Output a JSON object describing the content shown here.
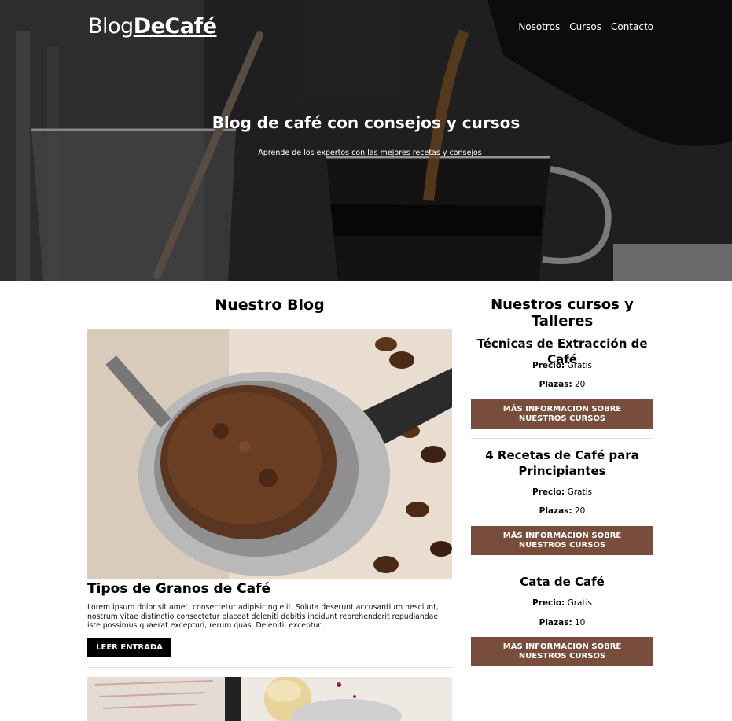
{
  "logo": {
    "light": "Blog",
    "bold": "DeCafé"
  },
  "nav": [
    "Nosotros",
    "Cursos",
    "Contacto"
  ],
  "hero": {
    "title": "Blog de café con consejos y cursos",
    "subtitle": "Aprende de los expertos con las mejores recetas y consejos"
  },
  "blog": {
    "heading": "Nuestro Blog",
    "posts": [
      {
        "title": "Tipos de Granos de Café",
        "excerpt": "Lorem ipsum dolor sit amet, consectetur adipisicing elit. Soluta deserunt accusantium nesciunt, nostrum vitae distinctio consectetur placeat deleniti debitis incidunt reprehenderit repudiandae iste possimus quaerat excepturi, rerum quas. Deleniti, excepturi.",
        "button": "LEER ENTRADA"
      }
    ]
  },
  "courses": {
    "heading": "Nuestros cursos y Talleres",
    "price_label": "Precio:",
    "seats_label": "Plazas:",
    "button": "MÁS INFORMACION SOBRE NUESTROS CURSOS",
    "items": [
      {
        "title": "Técnicas de Extracción de Café",
        "price": "Gratis",
        "seats": "20"
      },
      {
        "title": "4 Recetas de Café para Principiantes",
        "price": "Gratis",
        "seats": "20"
      },
      {
        "title": "Cata de Café",
        "price": "Gratis",
        "seats": "10"
      }
    ]
  },
  "colors": {
    "accent": "#784d3c",
    "button_dark": "#000000"
  }
}
